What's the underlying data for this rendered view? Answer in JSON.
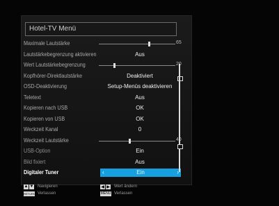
{
  "menu": {
    "title": "Hotel-TV Menü",
    "rows": [
      {
        "label": "Maximale Lautstärke",
        "type": "slider",
        "level": 65,
        "num": "65"
      },
      {
        "label": "Lautstärkebegrenzung aktivieren",
        "type": "value",
        "value": "Aus"
      },
      {
        "label": "Wert Lautstärkebegrenzung",
        "type": "slider",
        "level": 20,
        "num": "20"
      },
      {
        "label": "Kopfhörer-Direktlautstärke",
        "type": "value",
        "value": "Deaktiviert"
      },
      {
        "label": "OSD-Deaktivierung",
        "type": "value",
        "value": "Setup-Menüs deaktivieren"
      },
      {
        "label": "Teletext",
        "type": "value",
        "value": "Aus"
      },
      {
        "label": "Kopieren nach USB",
        "type": "value",
        "value": "OK"
      },
      {
        "label": "Kopieren von USB",
        "type": "value",
        "value": "OK"
      },
      {
        "label": "Weckzeit Kanal",
        "type": "value",
        "value": "0"
      },
      {
        "label": "Weckzeit Lautstärke",
        "type": "slider",
        "level": 40,
        "num": "40"
      },
      {
        "label": "USB-Option",
        "type": "value",
        "value": "Ein"
      },
      {
        "label": "Bild fixiert",
        "type": "value",
        "value": "Aus"
      },
      {
        "label": "Digitaler Tuner",
        "type": "selected",
        "value": "Ein"
      }
    ]
  },
  "footer": {
    "navigate_label": "Navigieren",
    "back_key": "RETURN/BACK",
    "back_label": "Verlassen",
    "change_label": "Wert ändern",
    "menu_key": "MENU",
    "menu_label": "Verlassen"
  },
  "colors": {
    "selection": "#16a0e0",
    "background": "#000000"
  }
}
